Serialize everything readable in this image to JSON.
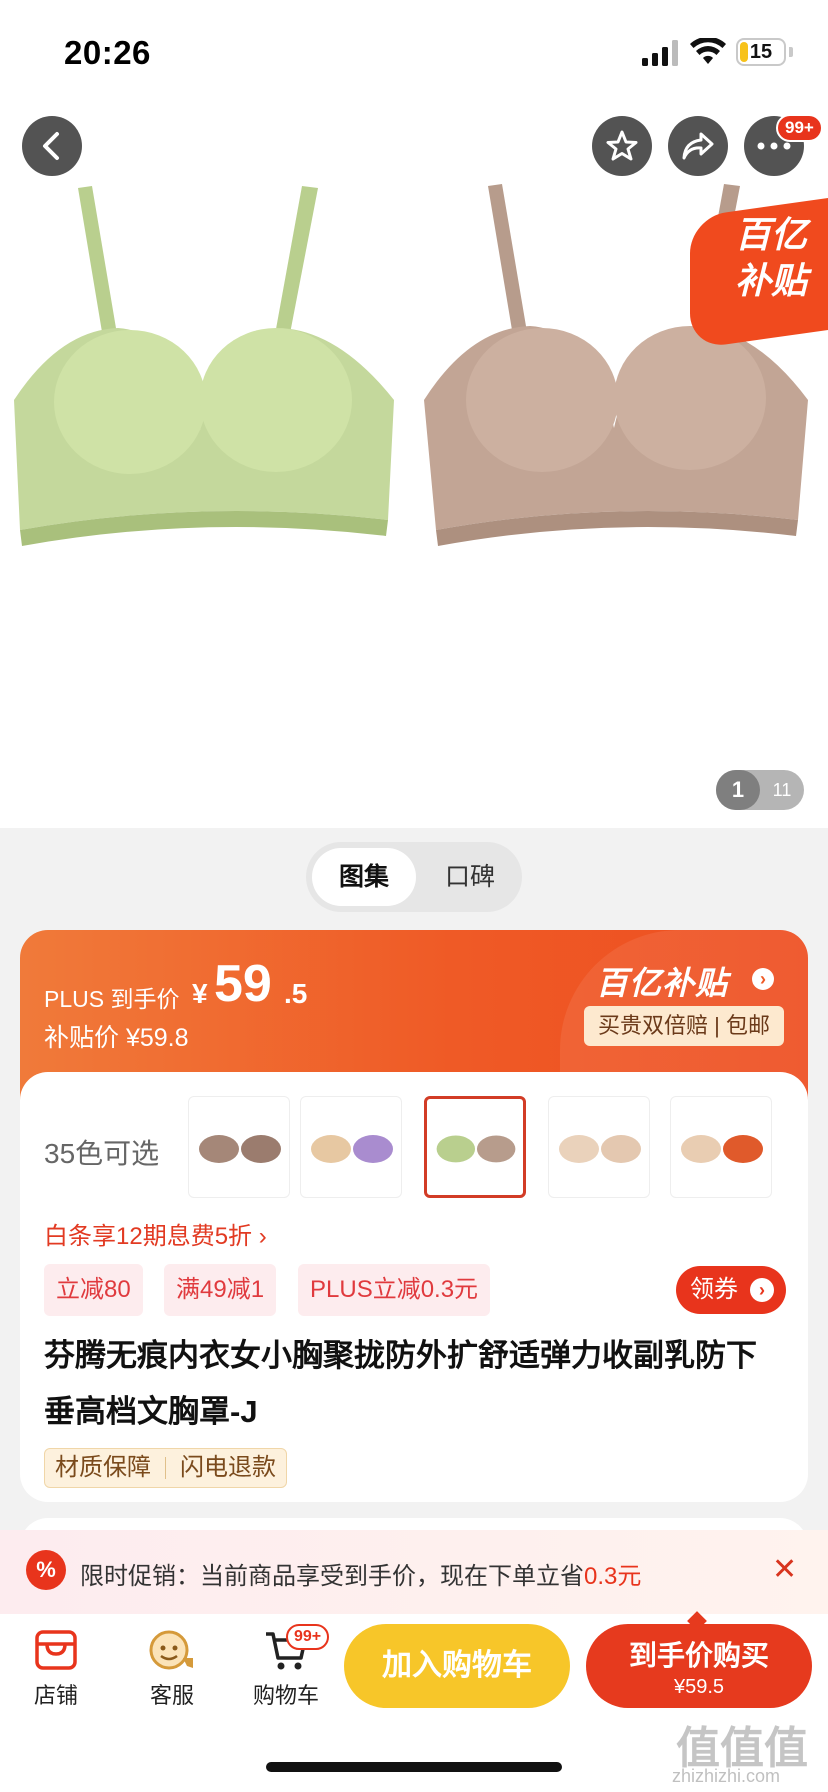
{
  "status": {
    "time": "20:26",
    "battery": "15"
  },
  "header": {
    "more_badge": "99+",
    "subsidy_line1": "百亿",
    "subsidy_line2": "补贴"
  },
  "gallery": {
    "current": "1",
    "total": "11"
  },
  "switch": {
    "active": "图集",
    "inactive": "口碑"
  },
  "price": {
    "plus_label": "PLUS 到手价",
    "yen": "¥",
    "integer": "59",
    "decimal": ".5",
    "subsidy_price": "补贴价 ¥59.8",
    "brand": "百亿补贴",
    "brand_pill": "买贵双倍赔 | 包邮"
  },
  "product": {
    "colors_label": "35色可选",
    "installment": "白条享12期息费5折 ›",
    "tags": [
      "立减80",
      "满49减1",
      "PLUS立减0.3元"
    ],
    "coupon": "领券",
    "title": "芬腾无痕内衣女小胸聚拢防外扩舒适弹力收副乳防下垂高档文胸罩-J",
    "guarantee_1": "材质保障",
    "guarantee_2": "闪电退款"
  },
  "promo": {
    "icon": "%",
    "text_prefix": "限时促销：当前商品享受到手价，现在下单立省",
    "saving": "0.3元",
    "close": "✕"
  },
  "bottom": {
    "shop": "店铺",
    "service": "客服",
    "cart": "购物车",
    "cart_badge": "99+",
    "add_cart": "加入购物车",
    "buy_now": "到手价购买",
    "buy_price": "¥59.5"
  },
  "watermark": {
    "main": "值值值",
    "url": "zhizhizhi.com"
  },
  "colors": {
    "accent": "#e8341c",
    "cart_yellow": "#f7c629",
    "banner_orange": "#ef5a26"
  }
}
